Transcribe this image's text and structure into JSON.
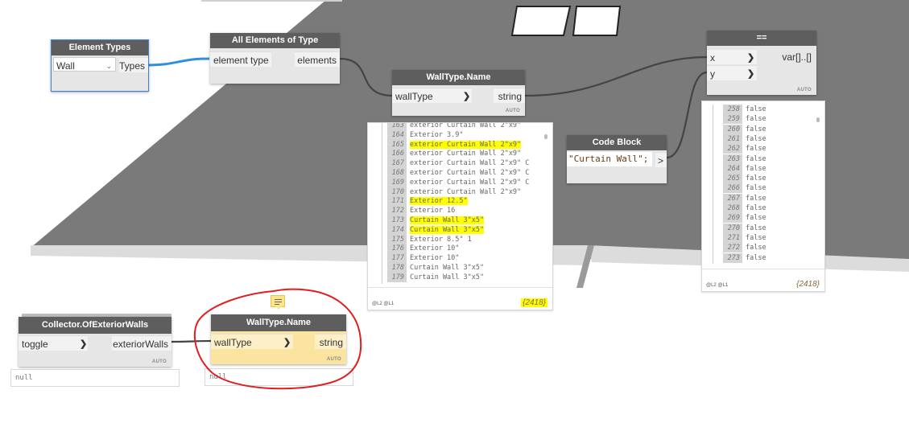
{
  "colors": {
    "wire_selected": "#2f8fd8",
    "wire": "#444444",
    "highlight": "#ffff00",
    "annotation": "#e02020",
    "note": "#fde58a"
  },
  "element_types": {
    "title": "Element Types",
    "selected": "Wall",
    "output": "Types"
  },
  "all_elements": {
    "title": "All Elements of Type",
    "input": "element type",
    "output": "elements"
  },
  "walltype_top": {
    "title": "WallType.Name",
    "input": "wallType",
    "output": "string",
    "auto": "AUTO"
  },
  "walltype_bottom": {
    "title": "WallType.Name",
    "input": "wallType",
    "output": "string",
    "auto": "AUTO",
    "preview": "null"
  },
  "code_block": {
    "title": "Code Block",
    "code": "\"Curtain Wall\";",
    "output": ">"
  },
  "equals": {
    "title": "==",
    "input_x": "x",
    "input_y": "y",
    "output": "var[]..[]",
    "auto": "AUTO"
  },
  "collector": {
    "title": "Collector.OfExteriorWalls",
    "input": "toggle",
    "output": "exteriorWalls",
    "auto": "AUTO",
    "preview": "null"
  },
  "names_preview": {
    "rows": [
      {
        "idx": "163",
        "val": "exterior Curtain Wall 2\"x9\"",
        "hl": false
      },
      {
        "idx": "164",
        "val": "Exterior 3.9\"",
        "hl": false
      },
      {
        "idx": "165",
        "val": "exterior Curtain Wall 2\"x9\"",
        "hl": true
      },
      {
        "idx": "166",
        "val": "exterior Curtain Wall 2\"x9\"",
        "hl": false
      },
      {
        "idx": "167",
        "val": "exterior Curtain Wall 2\"x9\" C",
        "hl": false
      },
      {
        "idx": "168",
        "val": "exterior Curtain Wall 2\"x9\" C",
        "hl": false
      },
      {
        "idx": "169",
        "val": "exterior Curtain Wall 2\"x9\" C",
        "hl": false
      },
      {
        "idx": "170",
        "val": "exterior Curtain Wall 2\"x9\"",
        "hl": false
      },
      {
        "idx": "171",
        "val": "Exterior 12.5\"",
        "hl": true
      },
      {
        "idx": "172",
        "val": "Exterior 16",
        "hl": false
      },
      {
        "idx": "173",
        "val": "Curtain Wall 3\"x5\"",
        "hl": true
      },
      {
        "idx": "174",
        "val": "Curtain Wall 3\"x5\"",
        "hl": true
      },
      {
        "idx": "175",
        "val": "Exterior 8.5\" 1",
        "hl": false
      },
      {
        "idx": "176",
        "val": "Exterior 10\"",
        "hl": false
      },
      {
        "idx": "177",
        "val": "Exterior 10\"",
        "hl": false
      },
      {
        "idx": "178",
        "val": "Curtain Wall 3\"x5\"",
        "hl": false
      },
      {
        "idx": "179",
        "val": "Curtain Wall 3\"x5\"",
        "hl": false
      }
    ],
    "levels": "@L2 @L1",
    "count": "{2418}"
  },
  "bool_preview": {
    "rows": [
      {
        "idx": "258",
        "val": "false"
      },
      {
        "idx": "259",
        "val": "false"
      },
      {
        "idx": "260",
        "val": "false"
      },
      {
        "idx": "261",
        "val": "false"
      },
      {
        "idx": "262",
        "val": "false"
      },
      {
        "idx": "263",
        "val": "false"
      },
      {
        "idx": "264",
        "val": "false"
      },
      {
        "idx": "265",
        "val": "false"
      },
      {
        "idx": "266",
        "val": "false"
      },
      {
        "idx": "267",
        "val": "false"
      },
      {
        "idx": "268",
        "val": "false"
      },
      {
        "idx": "269",
        "val": "false"
      },
      {
        "idx": "270",
        "val": "false"
      },
      {
        "idx": "271",
        "val": "false"
      },
      {
        "idx": "272",
        "val": "false"
      },
      {
        "idx": "273",
        "val": "false"
      }
    ],
    "levels": "@L2 @L1",
    "count": "{2418}"
  }
}
